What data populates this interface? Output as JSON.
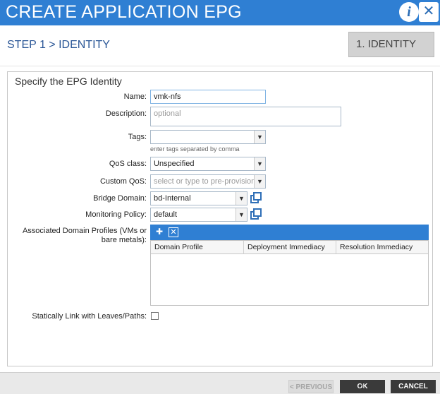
{
  "window": {
    "title": "CREATE APPLICATION EPG",
    "info_glyph": "i",
    "close_glyph": "✕"
  },
  "step": {
    "title": "STEP 1 > IDENTITY",
    "tab_label": "1. IDENTITY"
  },
  "form": {
    "header": "Specify the EPG Identity",
    "name_label": "Name:",
    "name_value": "vmk-nfs",
    "description_label": "Description:",
    "description_placeholder": "optional",
    "tags_label": "Tags:",
    "tags_hint": "enter tags separated by comma",
    "qos_label": "QoS class:",
    "qos_value": "Unspecified",
    "custom_qos_label": "Custom QoS:",
    "custom_qos_placeholder": "select or type to pre-provision",
    "bridge_domain_label": "Bridge Domain:",
    "bridge_domain_value": "bd-Internal",
    "monitoring_policy_label": "Monitoring Policy:",
    "monitoring_policy_value": "default",
    "assoc_label_line1": "Associated Domain Profiles (VMs or",
    "assoc_label_line2": "bare metals):",
    "assoc_columns": [
      "Domain Profile",
      "Deployment Immediacy",
      "Resolution Immediacy"
    ],
    "static_link_label": "Statically Link with Leaves/Paths:"
  },
  "footer": {
    "previous_label": "< PREVIOUS",
    "ok_label": "OK",
    "cancel_label": "CANCEL"
  },
  "icons": [
    "info-icon",
    "close-icon",
    "chevron-down-icon",
    "open-link-icon",
    "add-icon",
    "delete-icon",
    "pointer-cursor-icon"
  ],
  "colors": {
    "title_bar": "#2f7fd3",
    "step_title": "#2b5797",
    "button_dark": "#3a3a3a"
  }
}
